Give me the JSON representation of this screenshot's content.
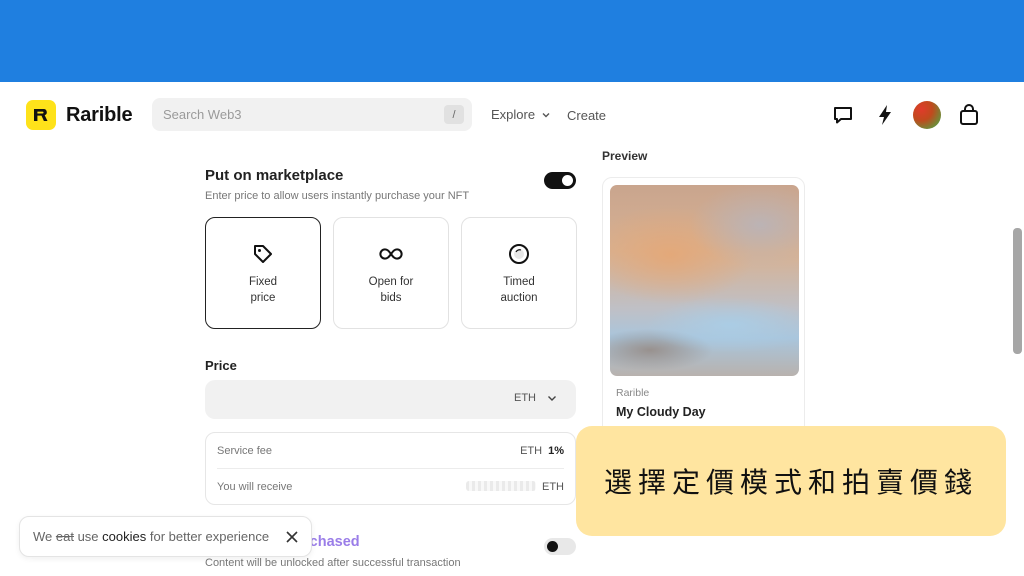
{
  "nav": {
    "logo_text": "Rarible",
    "search_placeholder": "Search Web3",
    "search_shortcut": "/",
    "explore_label": "Explore",
    "create_label": "Create",
    "icons": [
      "chat-icon",
      "lightning-icon",
      "avatar",
      "bag-icon"
    ]
  },
  "marketplace": {
    "title": "Put on marketplace",
    "subtitle": "Enter price to allow users instantly purchase your NFT",
    "enabled": true,
    "options": [
      {
        "line1": "Fixed",
        "line2": "price",
        "icon": "tag-icon",
        "selected": true
      },
      {
        "line1": "Open for",
        "line2": "bids",
        "icon": "infinity-icon",
        "selected": false
      },
      {
        "line1": "Timed",
        "line2": "auction",
        "icon": "clock-icon",
        "selected": false
      }
    ]
  },
  "price": {
    "label": "Price",
    "currency": "ETH"
  },
  "fees": {
    "service_fee_label": "Service fee",
    "service_fee_currency": "ETH",
    "service_fee_value": "1%",
    "receive_label": "You will receive",
    "receive_currency": "ETH"
  },
  "unlock": {
    "title_visible": "rchased",
    "subtitle": "Content will be unlocked after successful transaction",
    "enabled": false
  },
  "preview": {
    "label": "Preview",
    "brand": "Rarible",
    "name": "My Cloudy Day"
  },
  "cookie": {
    "prefix": "We ",
    "strike": "eat",
    "middle": " use ",
    "bold": "cookies",
    "suffix": " for better experience"
  },
  "callout": {
    "text": "選擇定價模式和拍賣價錢"
  },
  "colors": {
    "top_band": "#1f7fe0",
    "logo_yellow": "#fee21a",
    "callout_bg": "#ffe5a0",
    "accent_purple": "#9a7de8"
  }
}
